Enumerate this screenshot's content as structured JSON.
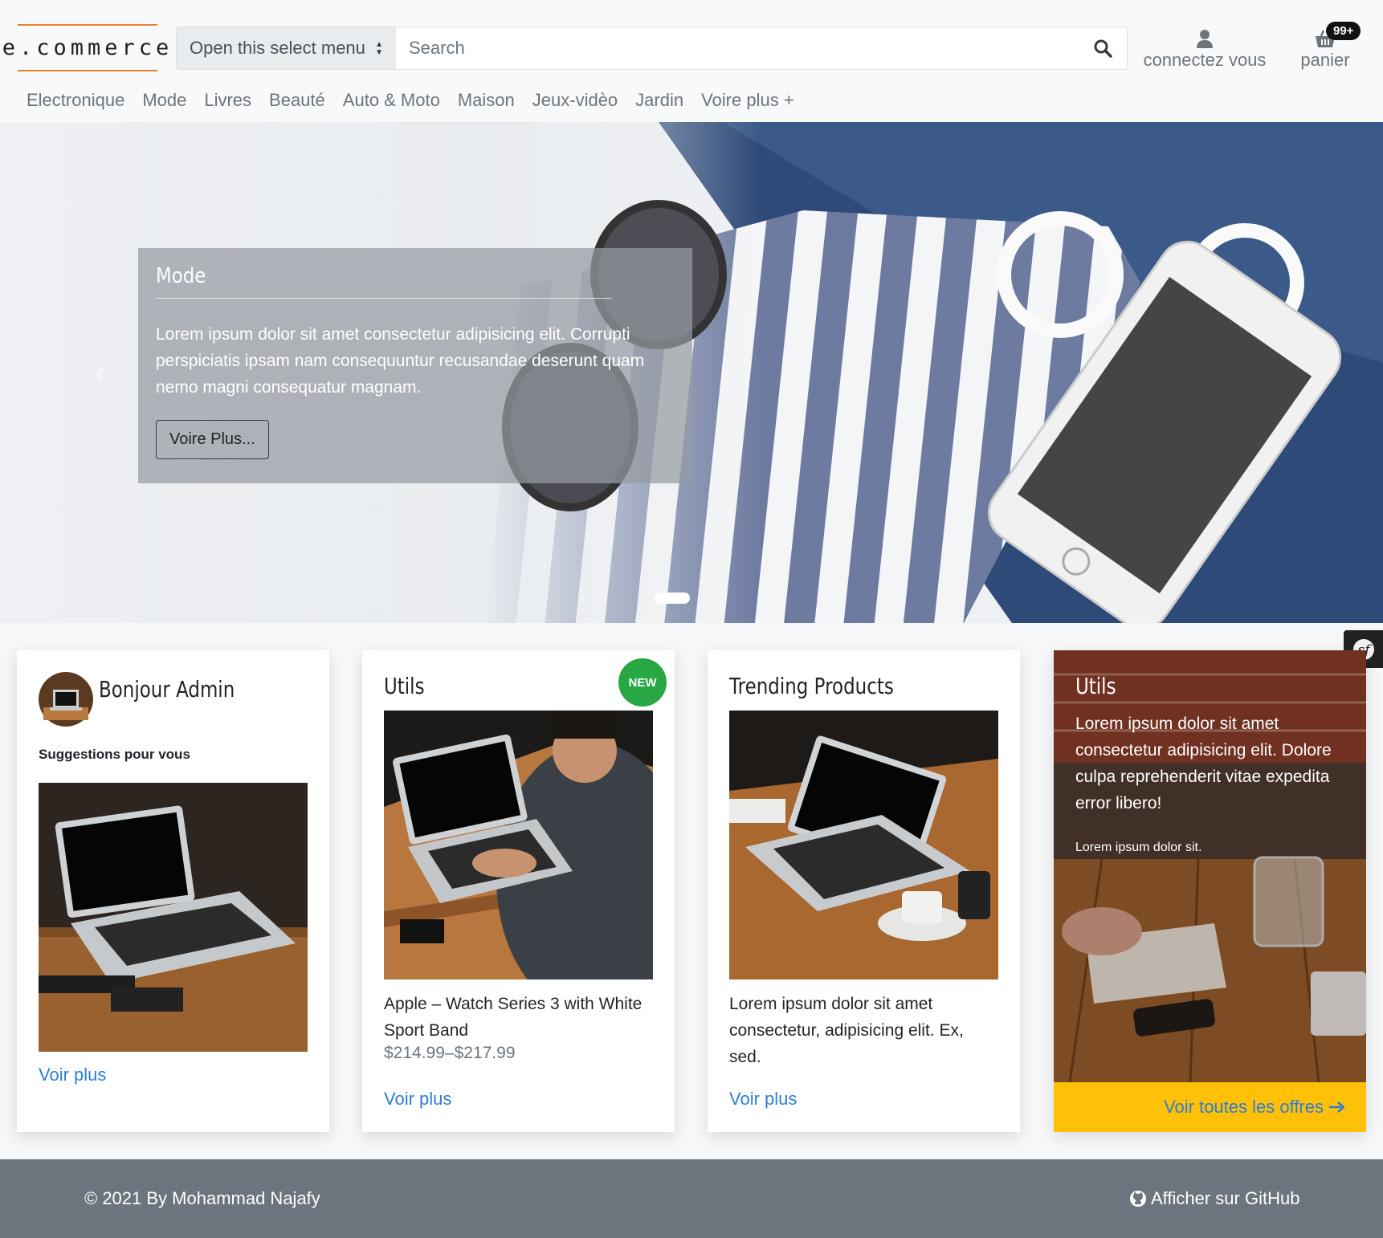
{
  "header": {
    "logo": "e.commerce",
    "select_label": "Open this select menu",
    "search_placeholder": "Search",
    "account_label": "connectez vous",
    "cart_label": "panier",
    "cart_badge": "99+"
  },
  "nav": {
    "items": [
      "Electronique",
      "Mode",
      "Livres",
      "Beauté",
      "Auto & Moto",
      "Maison",
      "Jeux-vidèo",
      "Jardin",
      "Voire plus +"
    ]
  },
  "hero": {
    "title": "Mode",
    "text": "Lorem ipsum dolor sit amet consectetur adipisicing elit. Corrupti perspiciatis ipsam nam consequuntur recusandae deserunt quam nemo magni consequatur magnam.",
    "button": "Voire Plus..."
  },
  "cards": {
    "welcome": {
      "title": "Bonjour Admin",
      "subtitle": "Suggestions pour vous",
      "link": "Voir plus"
    },
    "utils": {
      "title": "Utils",
      "badge": "NEW",
      "product": "Apple – Watch Series 3 with White Sport Band",
      "price": "$214.99–$217.99",
      "link": "Voir plus"
    },
    "trending": {
      "title": "Trending Products",
      "text": "Lorem ipsum dolor sit amet consectetur, adipisicing elit. Ex, sed.",
      "link": "Voir plus"
    },
    "offer": {
      "title": "Utils",
      "text": "Lorem ipsum dolor sit amet consectetur adipisicing elit. Dolore culpa reprehenderit vitae expedita error libero!",
      "small": "Lorem ipsum dolor sit.",
      "link": "Voir toutes les offres"
    }
  },
  "footer": {
    "copyright": "© 2021 By Mohammad Najafy",
    "github": "Afficher sur GitHub"
  },
  "colors": {
    "accent_logo": "#e8812a",
    "link": "#2f7cd4",
    "new_badge": "#28a745",
    "offer_footer": "#ffc107",
    "footer_bg": "#6c757d"
  },
  "icons": [
    "search-icon",
    "user-icon",
    "basket-icon",
    "chevron-left-icon",
    "github-icon",
    "arrow-right-icon",
    "symfony-icon"
  ]
}
